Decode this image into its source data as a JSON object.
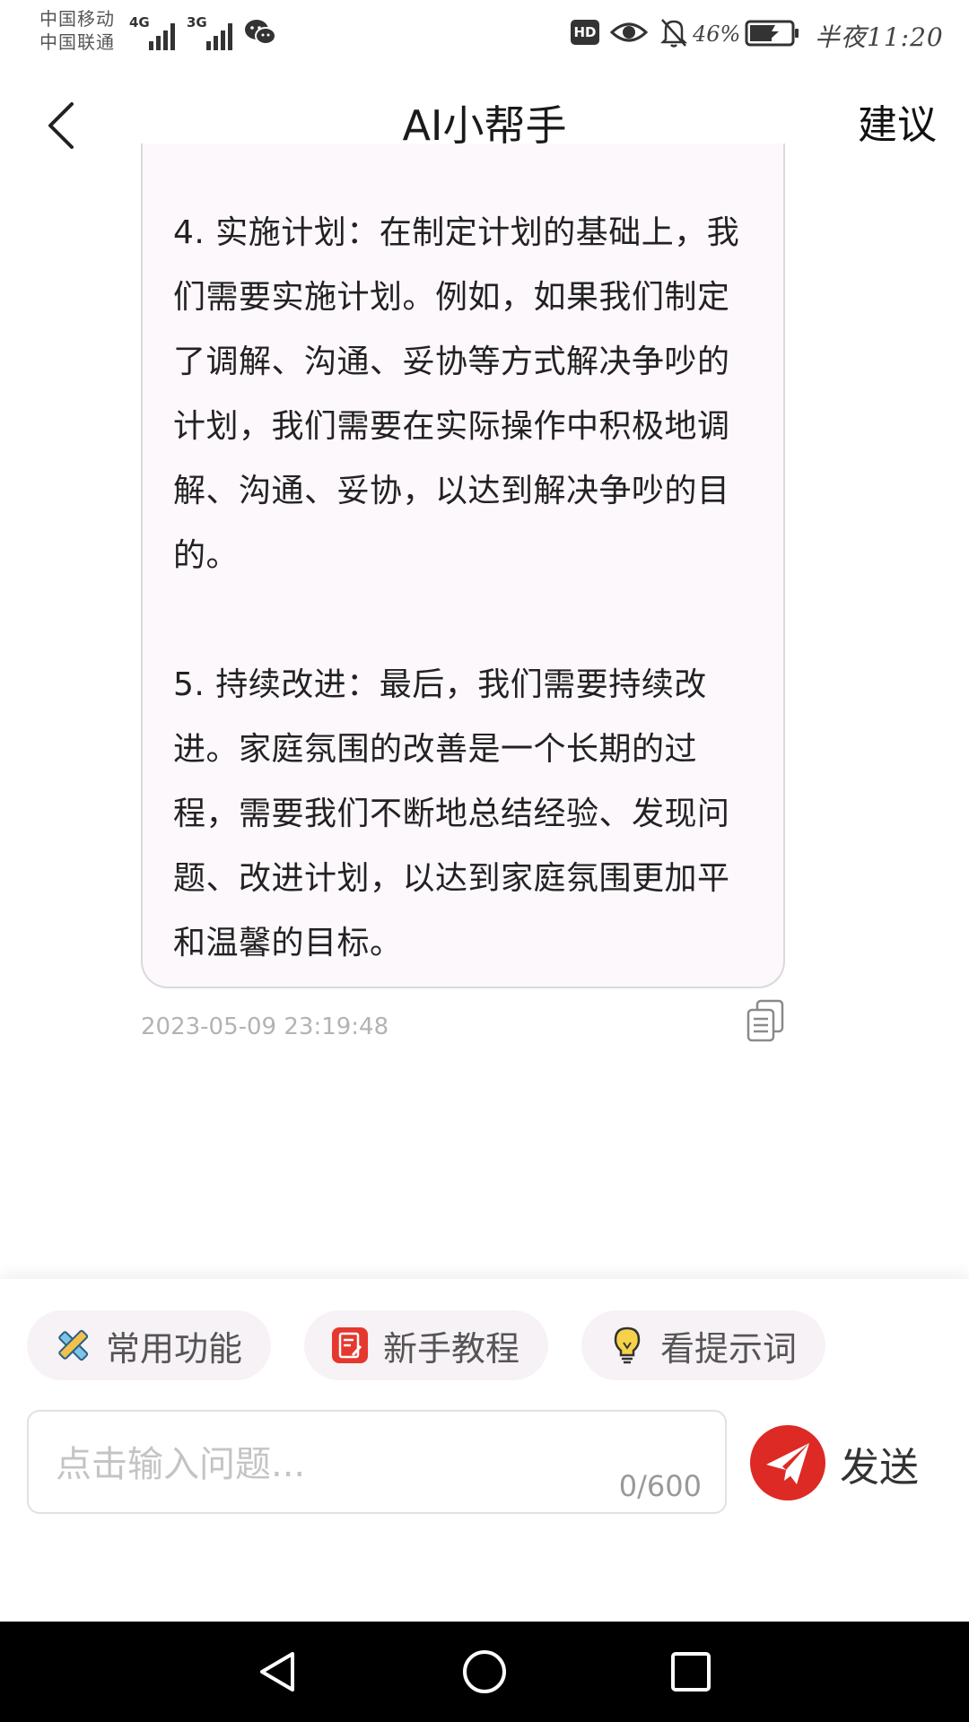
{
  "status_bar": {
    "carrier_1": "中国移动",
    "carrier_2": "中国联通",
    "signal_1": "4G",
    "signal_2": "3G",
    "hd_badge": "HD",
    "battery_percent": "46%",
    "time": "半夜11:20",
    "icons": [
      "signal-icon",
      "wechat-icon",
      "eye-icon",
      "mute-bell-icon",
      "battery-charging-icon"
    ]
  },
  "header": {
    "title": "AI小帮手",
    "suggest_label": "建议",
    "back_icon": "chevron-left-icon"
  },
  "message": {
    "text": "4. 实施计划：在制定计划的基础上，我们需要实施计划。例如，如果我们制定了调解、沟通、妥协等方式解决争吵的计划，我们需要在实际操作中积极地调解、沟通、妥协，以达到解决争吵的目的。\n\n5. 持续改进：最后，我们需要持续改进。家庭氛围的改善是一个长期的过程，需要我们不断地总结经验、发现问题、改进计划，以达到家庭氛围更加平和温馨的目标。",
    "timestamp": "2023-05-09 23:19:48",
    "copy_icon": "copy-icon"
  },
  "shortcuts": [
    {
      "label": "常用功能",
      "icon": "tools-icon"
    },
    {
      "label": "新手教程",
      "icon": "tutorial-icon"
    },
    {
      "label": "看提示词",
      "icon": "lightbulb-icon"
    }
  ],
  "composer": {
    "placeholder": "点击输入问题...",
    "counter": "0/600",
    "send_label": "发送",
    "send_icon": "paper-plane-icon",
    "accent": "#dd2a25"
  },
  "navbar": {
    "icons": [
      "back-triangle-icon",
      "home-circle-icon",
      "recents-square-icon"
    ]
  }
}
